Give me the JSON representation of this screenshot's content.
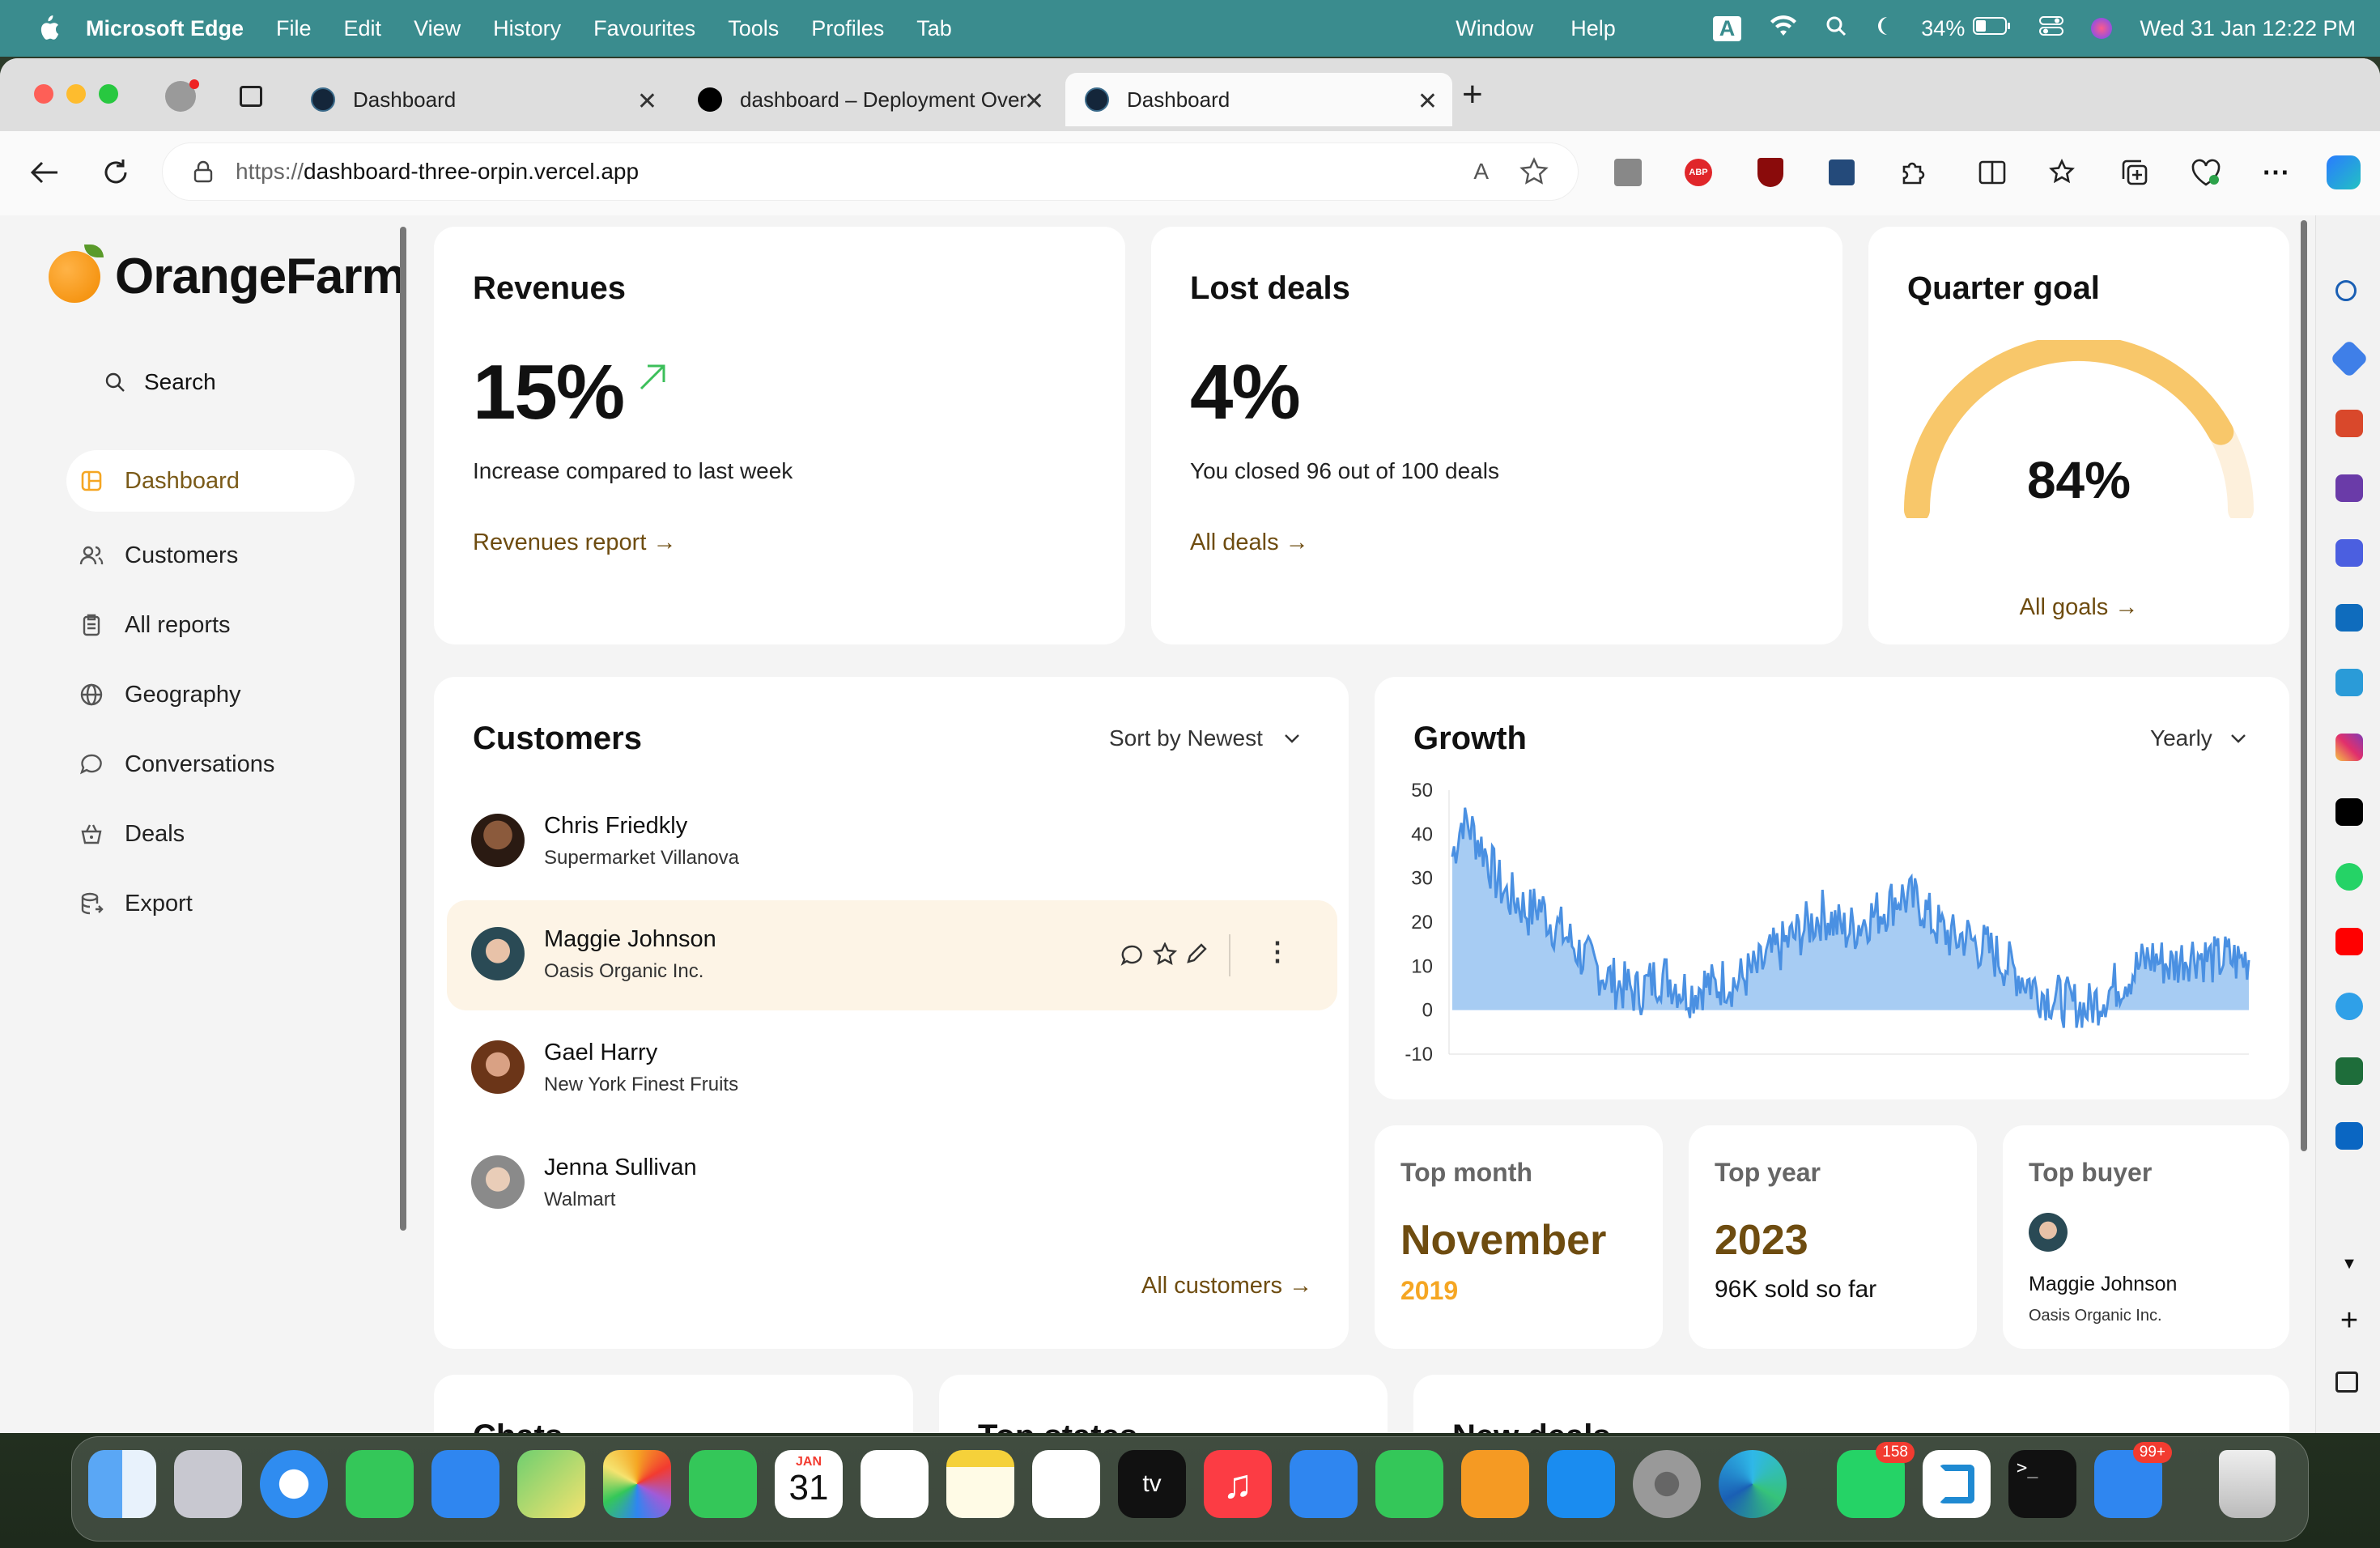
{
  "menubar": {
    "app": "Microsoft Edge",
    "items": [
      "File",
      "Edit",
      "View",
      "History",
      "Favourites",
      "Tools",
      "Profiles",
      "Tab"
    ],
    "right_items": [
      "Window",
      "Help"
    ],
    "battery": "34%",
    "datetime": "Wed 31 Jan  12:22 PM",
    "input_source": "A"
  },
  "tabs": [
    {
      "title": "Dashboard"
    },
    {
      "title": "dashboard – Deployment Over"
    },
    {
      "title": "Dashboard"
    }
  ],
  "address": {
    "proto": "https://",
    "host": "dashboard-three-orpin.vercel.app"
  },
  "brand": "OrangeFarm",
  "search_label": "Search",
  "nav": [
    "Dashboard",
    "Customers",
    "All reports",
    "Geography",
    "Conversations",
    "Deals",
    "Export"
  ],
  "revenues": {
    "title": "Revenues",
    "value": "15%",
    "subtitle": "Increase compared to last week",
    "link": "Revenues report →"
  },
  "lost": {
    "title": "Lost deals",
    "value": "4%",
    "subtitle": "You closed 96 out of 100 deals",
    "link": "All deals →"
  },
  "goal": {
    "title": "Quarter goal",
    "value": "84%",
    "link": "All goals →",
    "progress": 0.84
  },
  "customers": {
    "title": "Customers",
    "sort": "Sort by Newest",
    "link": "All customers →",
    "list": [
      {
        "name": "Chris Friedkly",
        "company": "Supermarket Villanova"
      },
      {
        "name": "Maggie Johnson",
        "company": "Oasis Organic Inc."
      },
      {
        "name": "Gael Harry",
        "company": "New York Finest Fruits"
      },
      {
        "name": "Jenna Sullivan",
        "company": "Walmart"
      }
    ]
  },
  "growth": {
    "title": "Growth",
    "period": "Yearly"
  },
  "chart_data": {
    "type": "area",
    "yticks": [
      "50",
      "40",
      "30",
      "20",
      "10",
      "0",
      "-10"
    ],
    "ylim": [
      -10,
      50
    ],
    "series": [
      {
        "values": [
          35,
          44,
          40,
          36,
          30,
          26,
          25,
          22,
          24,
          20,
          18,
          15,
          12,
          10,
          8,
          6,
          5,
          4,
          6,
          8,
          7,
          5,
          4,
          6,
          5,
          7,
          6,
          8,
          9,
          12,
          14,
          16,
          18,
          20,
          22,
          20,
          18,
          19,
          21,
          22,
          24,
          26,
          25,
          24,
          20,
          18,
          16,
          17,
          15,
          14,
          12,
          10,
          8,
          6,
          4,
          3,
          2,
          1,
          0,
          2,
          4,
          6,
          8,
          10,
          12,
          11,
          10,
          12,
          13,
          12,
          11,
          12,
          11,
          12
        ]
      }
    ]
  },
  "top_month": {
    "label": "Top month",
    "value": "November",
    "year": "2019"
  },
  "top_year": {
    "label": "Top year",
    "value": "2023",
    "note": "96K sold so far"
  },
  "top_buyer": {
    "label": "Top buyer",
    "name": "Maggie Johnson",
    "company": "Oasis Organic Inc."
  },
  "bottom": {
    "chats": "Chats",
    "states": "Top states",
    "deals": "New deals"
  },
  "dock_badges": {
    "whatsapp": "158",
    "mail": "99+"
  },
  "calendar": {
    "month": "JAN",
    "day": "31"
  },
  "colors": {
    "accent": "#6e4c10",
    "orange": "#f5a623",
    "gauge": "#f8c76a",
    "chart": "#4a90e2",
    "menubar": "#3a8c8e"
  }
}
